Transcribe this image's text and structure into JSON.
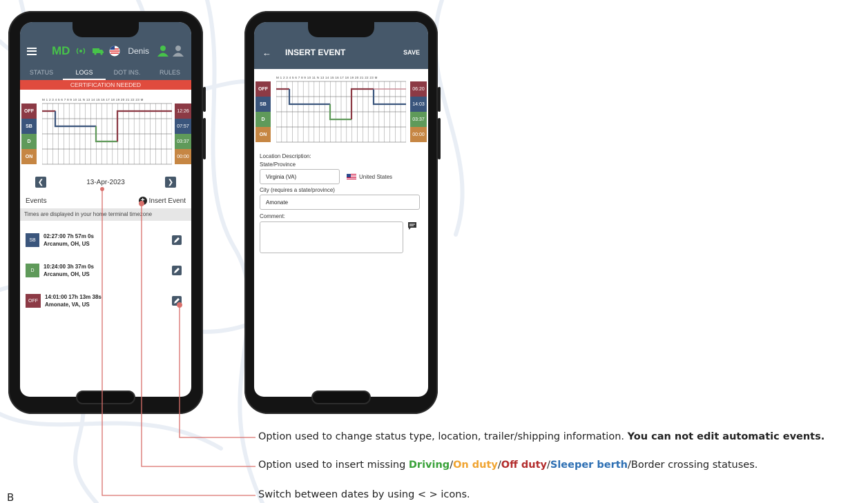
{
  "colors": {
    "header": "#46586a",
    "off": "#8c3a45",
    "sb": "#3a557c",
    "d": "#5f9a5a",
    "on": "#c68643",
    "cert": "#e04b3e"
  },
  "phone1": {
    "header": {
      "brand": "MD",
      "user": "Denis",
      "icons": [
        "menu-icon",
        "signal-icon",
        "truck-icon",
        "flag-us-icon",
        "user-green-icon",
        "user-gray-icon"
      ]
    },
    "tabs": [
      "STATUS",
      "LOGS",
      "DOT INS.",
      "RULES"
    ],
    "active_tab": "LOGS",
    "certification": "CERTIFICATION NEEDED",
    "graph": {
      "hours_label": "M 1 2 3 4 5 6 7 8 9 10 11 N 13 14 15 16 17 18 19 20 21 22 23 M",
      "rows": [
        "OFF",
        "SB",
        "D",
        "ON"
      ],
      "totals": [
        "12:26",
        "07:57",
        "03:37",
        "00:00"
      ]
    },
    "date": "13-Apr-2023",
    "events_label": "Events",
    "insert_event": "Insert Event",
    "tz_note": "Times are displayed in your home terminal timezone",
    "events": [
      {
        "status": "SB",
        "time": "02:27:00   7h 57m 0s",
        "location": "Arcanum, OH, US"
      },
      {
        "status": "D",
        "time": "10:24:00   3h 37m 0s",
        "location": "Arcanum, OH, US"
      },
      {
        "status": "OFF",
        "time": "14:01:00   17h 13m 38s",
        "location": "Amonate, VA, US"
      }
    ]
  },
  "phone2": {
    "title": "INSERT EVENT",
    "save": "SAVE",
    "graph": {
      "hours_label": "M 1 2 3 4 5 6 7 8 9 10 11 N 13 14 15 16 17 18 19 20 21 22 23 M",
      "rows": [
        "OFF",
        "SB",
        "D",
        "ON"
      ],
      "totals": [
        "06:20",
        "14:03",
        "03:37",
        "00:00"
      ]
    },
    "form": {
      "location_desc": "Location Description:",
      "state_label": "State/Province",
      "state_value": "Virginia (VA)",
      "country": "United States",
      "city_label": "City (requires a state/province)",
      "city_value": "Amonate",
      "comment_label": "Comment:",
      "comment_value": ""
    }
  },
  "callouts": {
    "edit": {
      "text": "Option used to change status type, location, trailer/shipping information. ",
      "bold": "You can not edit automatic events."
    },
    "insert": {
      "prefix": "Option used to insert missing ",
      "driving": "Driving",
      "sep1": "/",
      "on_duty": "On duty",
      "sep2": "/",
      "off_duty": "Off duty",
      "sep3": "/",
      "sleeper": "Sleeper berth",
      "suffix": "/Border crossing statuses."
    },
    "dates": "Switch between dates by using < > icons."
  },
  "section_letter": "B"
}
